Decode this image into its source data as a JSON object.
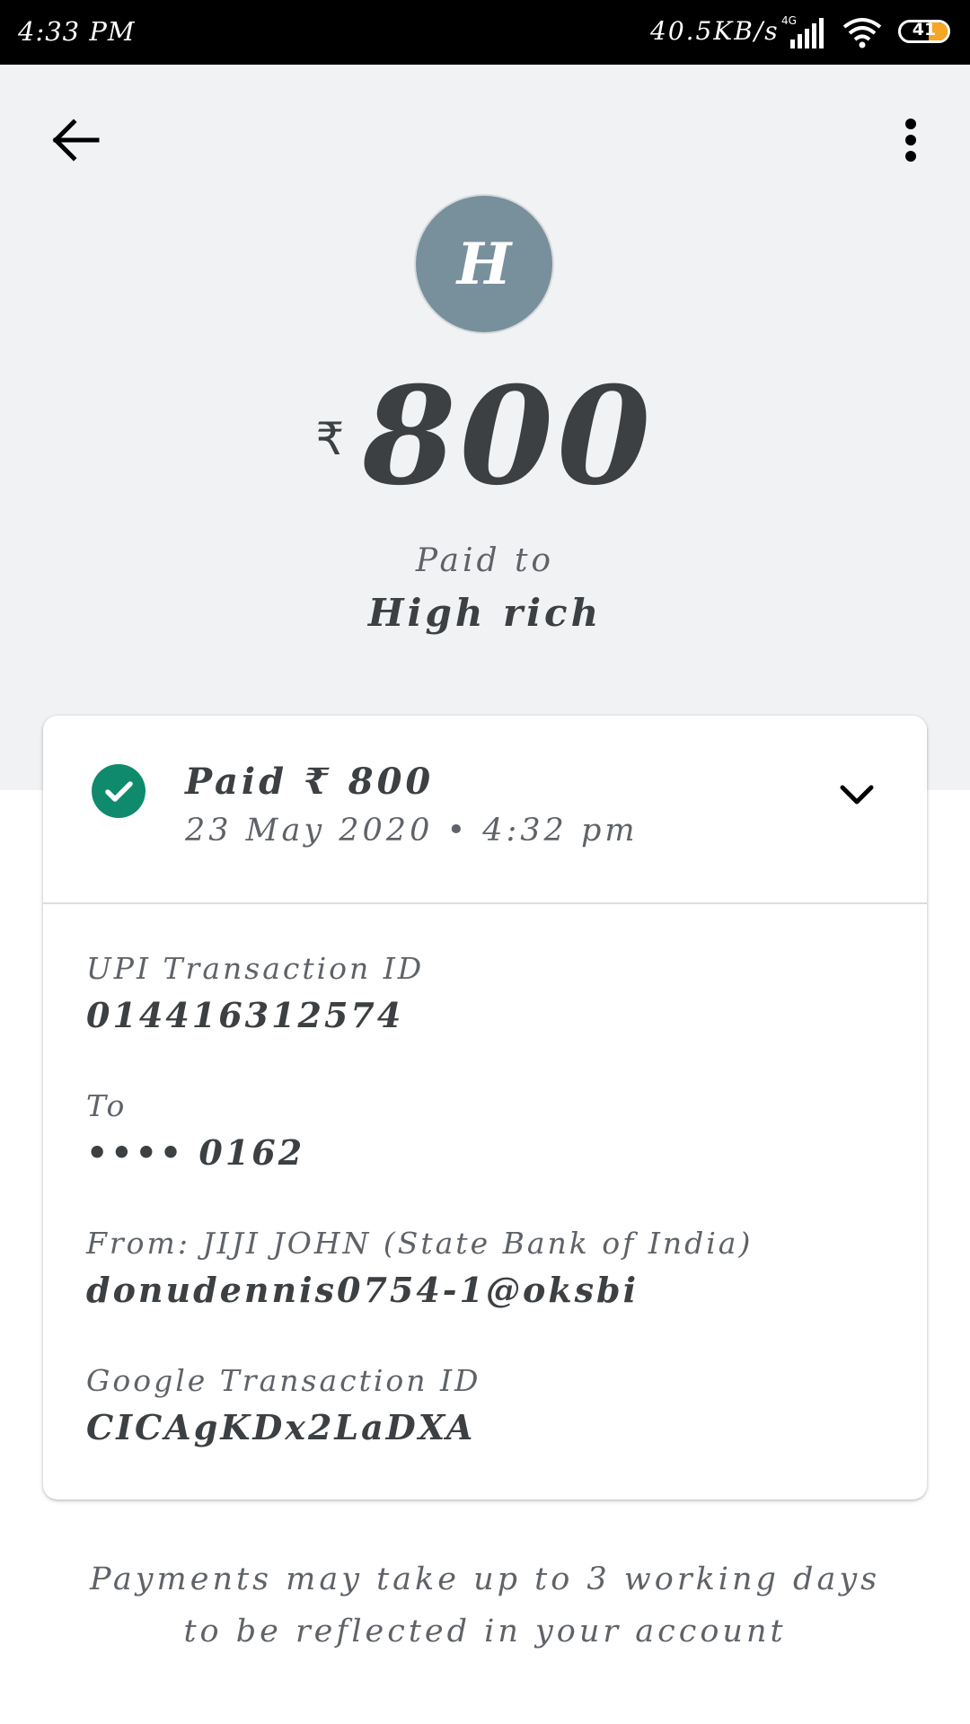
{
  "status_bar": {
    "time": "4:33 PM",
    "network_speed": "40.5KB/s",
    "network_type": "4G",
    "battery_level": "41",
    "battery_fraction": 0.41
  },
  "header": {
    "back_icon": "arrow-back-icon",
    "more_icon": "more-vert-icon"
  },
  "payee": {
    "avatar_initial": "H",
    "avatar_color": "#78909c",
    "currency_symbol": "₹",
    "amount": "800",
    "paid_to_label": "Paid to",
    "name": "High rich"
  },
  "transaction": {
    "status_title": "Paid ₹ 800",
    "status_date": "23 May 2020 • 4:32 pm",
    "status_color": "#0f8a6c",
    "details": [
      {
        "label": "UPI Transaction ID",
        "value": "014416312574"
      },
      {
        "label": "To",
        "value": "•••• 0162"
      },
      {
        "label": "From: JIJI  JOHN (State Bank of India)",
        "value": "donudennis0754-1@oksbi"
      },
      {
        "label": "Google Transaction ID",
        "value": "CICAgKDx2LaDXA"
      }
    ]
  },
  "footer": {
    "line1": "Payments may take up to 3 working days",
    "line2": "to be reflected in your account"
  }
}
